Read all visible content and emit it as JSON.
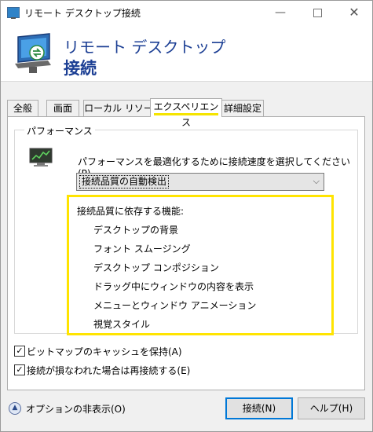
{
  "window": {
    "title": "リモート デスクトップ接続",
    "minimize": "—",
    "close": "✕"
  },
  "banner": {
    "line1": "リモート デスクトップ",
    "line2": "接続"
  },
  "tabs": [
    {
      "label": "全般"
    },
    {
      "label": "画面"
    },
    {
      "label": "ローカル リソース"
    },
    {
      "label": "エクスペリエンス"
    },
    {
      "label": "詳細設定"
    }
  ],
  "active_tab": "エクスペリエンス",
  "performance": {
    "legend": "パフォーマンス",
    "label": "パフォーマンスを最適化するために接続速度を選択してください(P)",
    "selected": "接続品質の自動検出",
    "dropdown_arrow": "⌵",
    "dependent_title": "接続品質に依存する機能:",
    "dependent_items": [
      "デスクトップの背景",
      "フォント スムージング",
      "デスクトップ コンポジション",
      "ドラッグ中にウィンドウの内容を表示",
      "メニューとウィンドウ アニメーション",
      "視覚スタイル"
    ]
  },
  "checkboxes": [
    {
      "label": "ビットマップのキャッシュを保持(A)",
      "checked": true,
      "mark": "✓"
    },
    {
      "label": "接続が損なわれた場合は再接続する(E)",
      "checked": true,
      "mark": "✓"
    }
  ],
  "options_toggle": {
    "label": "オプションの非表示(O)",
    "icon": "▲"
  },
  "buttons": {
    "connect": "接続(N)",
    "help": "ヘルプ(H)"
  },
  "colors": {
    "highlight": "#ffe400",
    "brand_blue": "#1c3f94",
    "focus_blue": "#0078d7"
  }
}
